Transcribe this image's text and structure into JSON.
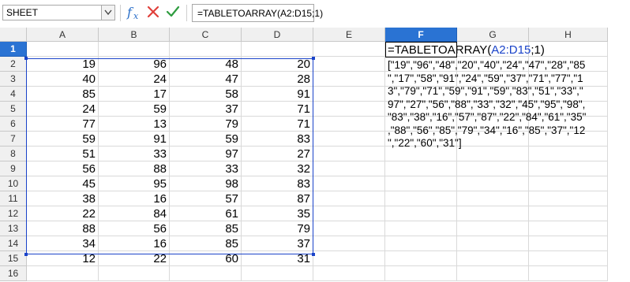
{
  "formula_bar": {
    "name_box": "SHEET",
    "function_icon": "function-wizard-icon",
    "cancel_icon": "cancel-icon",
    "accept_icon": "accept-icon",
    "formula": "=TABLETOARRAY(A2:D15;1)"
  },
  "columns": [
    "A",
    "B",
    "C",
    "D",
    "E",
    "F",
    "G",
    "H"
  ],
  "selected_column": "F",
  "rows": [
    "1",
    "2",
    "3",
    "4",
    "5",
    "6",
    "7",
    "8",
    "9",
    "10",
    "11",
    "12",
    "13",
    "14",
    "15",
    "16"
  ],
  "selected_row": "1",
  "table": [
    [
      "19",
      "96",
      "48",
      "20"
    ],
    [
      "40",
      "24",
      "47",
      "28"
    ],
    [
      "85",
      "17",
      "58",
      "91"
    ],
    [
      "24",
      "59",
      "37",
      "71"
    ],
    [
      "77",
      "13",
      "79",
      "71"
    ],
    [
      "59",
      "91",
      "59",
      "83"
    ],
    [
      "51",
      "33",
      "97",
      "27"
    ],
    [
      "56",
      "88",
      "33",
      "32"
    ],
    [
      "45",
      "95",
      "98",
      "83"
    ],
    [
      "38",
      "16",
      "57",
      "87"
    ],
    [
      "22",
      "84",
      "61",
      "35"
    ],
    [
      "88",
      "56",
      "85",
      "79"
    ],
    [
      "34",
      "16",
      "85",
      "37"
    ],
    [
      "12",
      "22",
      "60",
      "31"
    ]
  ],
  "cell_F1": {
    "prefix": "=TABLETOARRAY(",
    "ref": "A2:D15",
    "suffix": ";1)"
  },
  "cell_F2_lines": [
    "[\"19\",\"96\",\"48\",\"20\",\"40\",\"24\",\"47\",\"28\",\"85",
    "\",\"17\",\"58\",\"91\",\"24\",\"59\",\"37\",\"71\",\"77\",\"1",
    "3\",\"79\",\"71\",\"59\",\"91\",\"59\",\"83\",\"51\",\"33\",\"",
    "97\",\"27\",\"56\",\"88\",\"33\",\"32\",\"45\",\"95\",\"98\",",
    "\"83\",\"38\",\"16\",\"57\",\"87\",\"22\",\"84\",\"61\",\"35\"",
    ",\"88\",\"56\",\"85\",\"79\",\"34\",\"16\",\"85\",\"37\",\"12",
    "\",\"22\",\"60\",\"31\"]"
  ],
  "colors": {
    "selection_header": "#2a73d3",
    "range_border": "#1a43c9",
    "cancel": "#e0403a",
    "accept": "#2e9c3f"
  }
}
